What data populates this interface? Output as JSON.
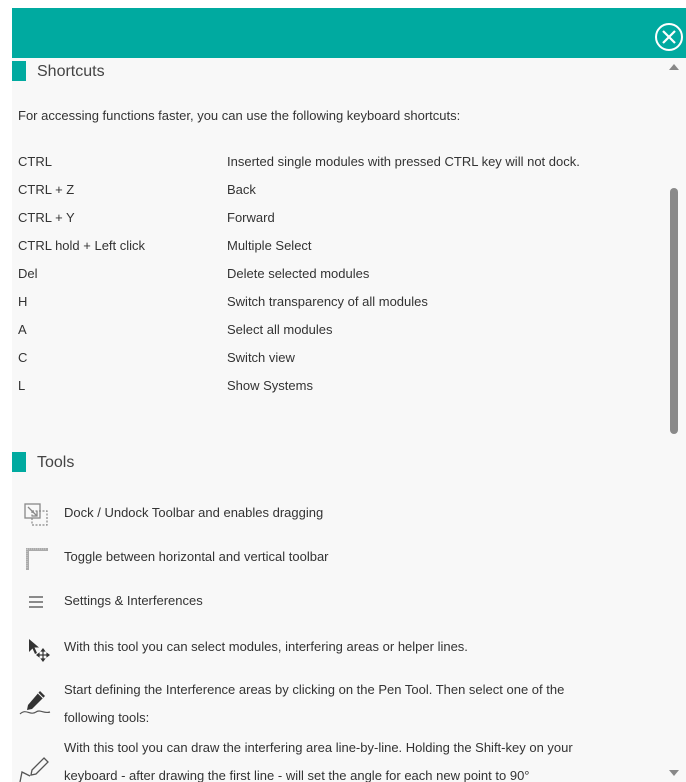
{
  "shortcuts": {
    "title": "Shortcuts",
    "intro": "For accessing functions faster, you can use the following keyboard shortcuts:",
    "rows": [
      {
        "key": "CTRL",
        "desc": "Inserted single modules with pressed CTRL key will not dock."
      },
      {
        "key": "CTRL + Z",
        "desc": "Back"
      },
      {
        "key": "CTRL + Y",
        "desc": "Forward"
      },
      {
        "key": "CTRL hold + Left click",
        "desc": "Multiple Select"
      },
      {
        "key": "Del",
        "desc": "Delete selected modules"
      },
      {
        "key": "H",
        "desc": "Switch transparency of all modules"
      },
      {
        "key": "A",
        "desc": "Select all modules"
      },
      {
        "key": "C",
        "desc": "Switch view"
      },
      {
        "key": "L",
        "desc": "Show Systems"
      }
    ]
  },
  "tools": {
    "title": "Tools",
    "items": [
      {
        "icon": "dock-toolbar-icon",
        "text": "Dock / Undock Toolbar and enables dragging"
      },
      {
        "icon": "toggle-orientation-icon",
        "text": "Toggle between horizontal and vertical toolbar"
      },
      {
        "icon": "hamburger-menu-icon",
        "text": "Settings & Interferences"
      },
      {
        "icon": "select-move-cursor-icon",
        "text": "With this tool you can select modules, interfering areas or helper lines."
      },
      {
        "icon": "pen-tool-icon",
        "text_line1": "Start defining the Interference areas by clicking on the Pen Tool. Then select one of the",
        "text_line2": "following tools:"
      },
      {
        "icon": "line-by-line-pen-icon",
        "text_line1": "With this tool you can draw the interfering area line-by-line. Holding the Shift-key on your",
        "text_line2": "keyboard - after drawing the first line - will set the angle for each new point to 90°"
      }
    ]
  },
  "colors": {
    "accent": "#00aaa0",
    "background": "#f8f8f8"
  }
}
